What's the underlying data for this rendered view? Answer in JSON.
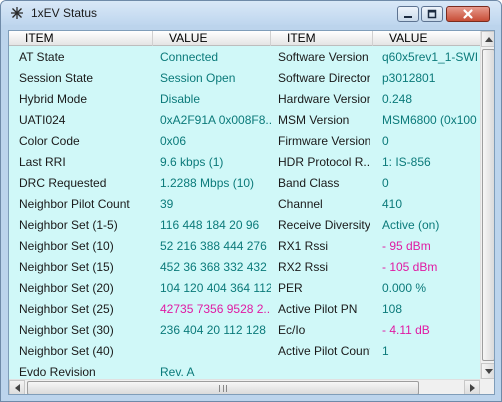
{
  "window": {
    "title": "1xEV Status",
    "icon": "asterisk-app-icon"
  },
  "columns": {
    "item_left": "ITEM",
    "value_left": "VALUE",
    "item_right": "ITEM",
    "value_right": "VALUE"
  },
  "rows": [
    {
      "item1": "AT State",
      "value1": "Connected",
      "item2": "Software Version",
      "value2": "q60x5rev1_1-SWI"
    },
    {
      "item1": "Session State",
      "value1": "Session Open",
      "item2": "Software Directory",
      "value2": "p3012801"
    },
    {
      "item1": "Hybrid Mode",
      "value1": "Disable",
      "item2": "Hardware Version",
      "value2": "0.248"
    },
    {
      "item1": "UATI024",
      "value1": "0xA2F91A 0x008F8...",
      "item2": "MSM Version",
      "value2": "MSM6800 (0x100"
    },
    {
      "item1": "Color Code",
      "value1": "0x06",
      "item2": "Firmware Version",
      "value2": "0"
    },
    {
      "item1": "Last RRI",
      "value1": "9.6 kbps (1)",
      "item2": "HDR Protocol R...",
      "value2": "1: IS-856"
    },
    {
      "item1": "DRC Requested",
      "value1": "1.2288 Mbps (10)",
      "item2": "Band Class",
      "value2": "0"
    },
    {
      "item1": "Neighbor Pilot Count",
      "value1": "39",
      "item2": "Channel",
      "value2": "410"
    },
    {
      "item1": "Neighbor Set (1-5)",
      "value1": "116 448 184 20 96",
      "item2": "Receive Diversity",
      "value2": "Active (on)"
    },
    {
      "item1": "Neighbor Set (10)",
      "value1": "52 216 388 444 276",
      "item2": "RX1 Rssi",
      "value2": "- 95 dBm"
    },
    {
      "item1": "Neighbor Set (15)",
      "value1": "452 36 368 332 432",
      "item2": "RX2 Rssi",
      "value2": "- 105 dBm"
    },
    {
      "item1": "Neighbor Set (20)",
      "value1": "104 120 404 364 112",
      "item2": "PER",
      "value2": "0.000 %"
    },
    {
      "item1": "Neighbor Set (25)",
      "value1": "42735 7356 9528 2...",
      "item2": "Active Pilot PN",
      "value2": "108"
    },
    {
      "item1": "Neighbor Set (30)",
      "value1": "236 404 20 112 128",
      "item2": "Ec/Io",
      "value2": "- 4.11 dB"
    },
    {
      "item1": "Neighbor Set (40)",
      "value1": "",
      "item2": "Active Pilot Count",
      "value2": "1"
    },
    {
      "item1": "Evdo Revision",
      "value1": "Rev. A",
      "item2": "",
      "value2": ""
    }
  ],
  "colors": {
    "value_text": "#0b7a7a",
    "highlight_text": "#e01aa3",
    "list_background": "#d0f8f8"
  },
  "scrollbars": {
    "vertical_up": "up-arrow-icon",
    "vertical_down": "down-arrow-icon",
    "horizontal_left": "left-arrow-icon",
    "horizontal_right": "right-arrow-icon"
  }
}
